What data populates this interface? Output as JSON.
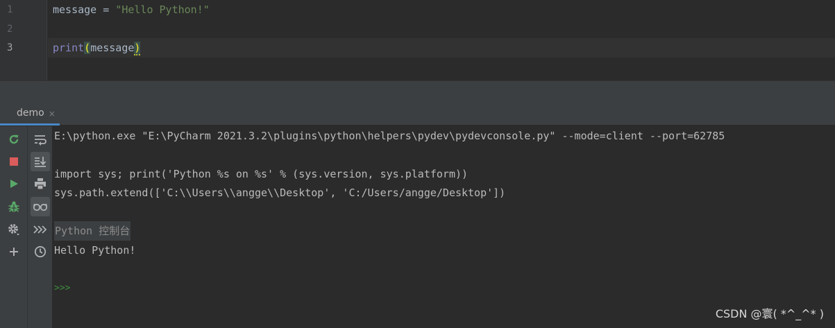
{
  "editor": {
    "line_numbers": [
      "1",
      "2",
      "3"
    ],
    "line1": {
      "ident": "message",
      "op": " = ",
      "string": "\"Hello Python!\""
    },
    "line3": {
      "builtin": "print",
      "open": "(",
      "arg": "message",
      "close": ")"
    }
  },
  "tool_window": {
    "tab_label": "demo",
    "tab_close": "×"
  },
  "toolbar_left": [
    {
      "name": "rerun-icon",
      "color": "#59a869"
    },
    {
      "name": "stop-icon",
      "color": "#db5c5c"
    },
    {
      "name": "run-icon",
      "color": "#59a869"
    },
    {
      "name": "debug-icon",
      "color": "#59a869"
    },
    {
      "name": "settings-icon",
      "color": "#afb1b3"
    },
    {
      "name": "add-icon",
      "color": "#afb1b3"
    }
  ],
  "toolbar_right": [
    {
      "name": "soft-wrap-icon"
    },
    {
      "name": "scroll-to-end-icon",
      "active": true
    },
    {
      "name": "print-icon"
    },
    {
      "name": "show-variables-icon",
      "active": true
    },
    {
      "name": "execute-icon"
    },
    {
      "name": "history-icon"
    }
  ],
  "console": {
    "lines": [
      "E:\\python.exe \"E:\\PyCharm 2021.3.2\\plugins\\python\\helpers\\pydev\\pydevconsole.py\" --mode=client --port=62785",
      "import sys; print('Python %s on %s' % (sys.version, sys.platform))",
      "sys.path.extend(['C:\\\\Users\\\\angge\\\\Desktop', 'C:/Users/angge/Desktop'])",
      "Python 控制台",
      "Hello Python!",
      ">>>"
    ]
  },
  "watermark": "CSDN @寰( *^_^* )"
}
